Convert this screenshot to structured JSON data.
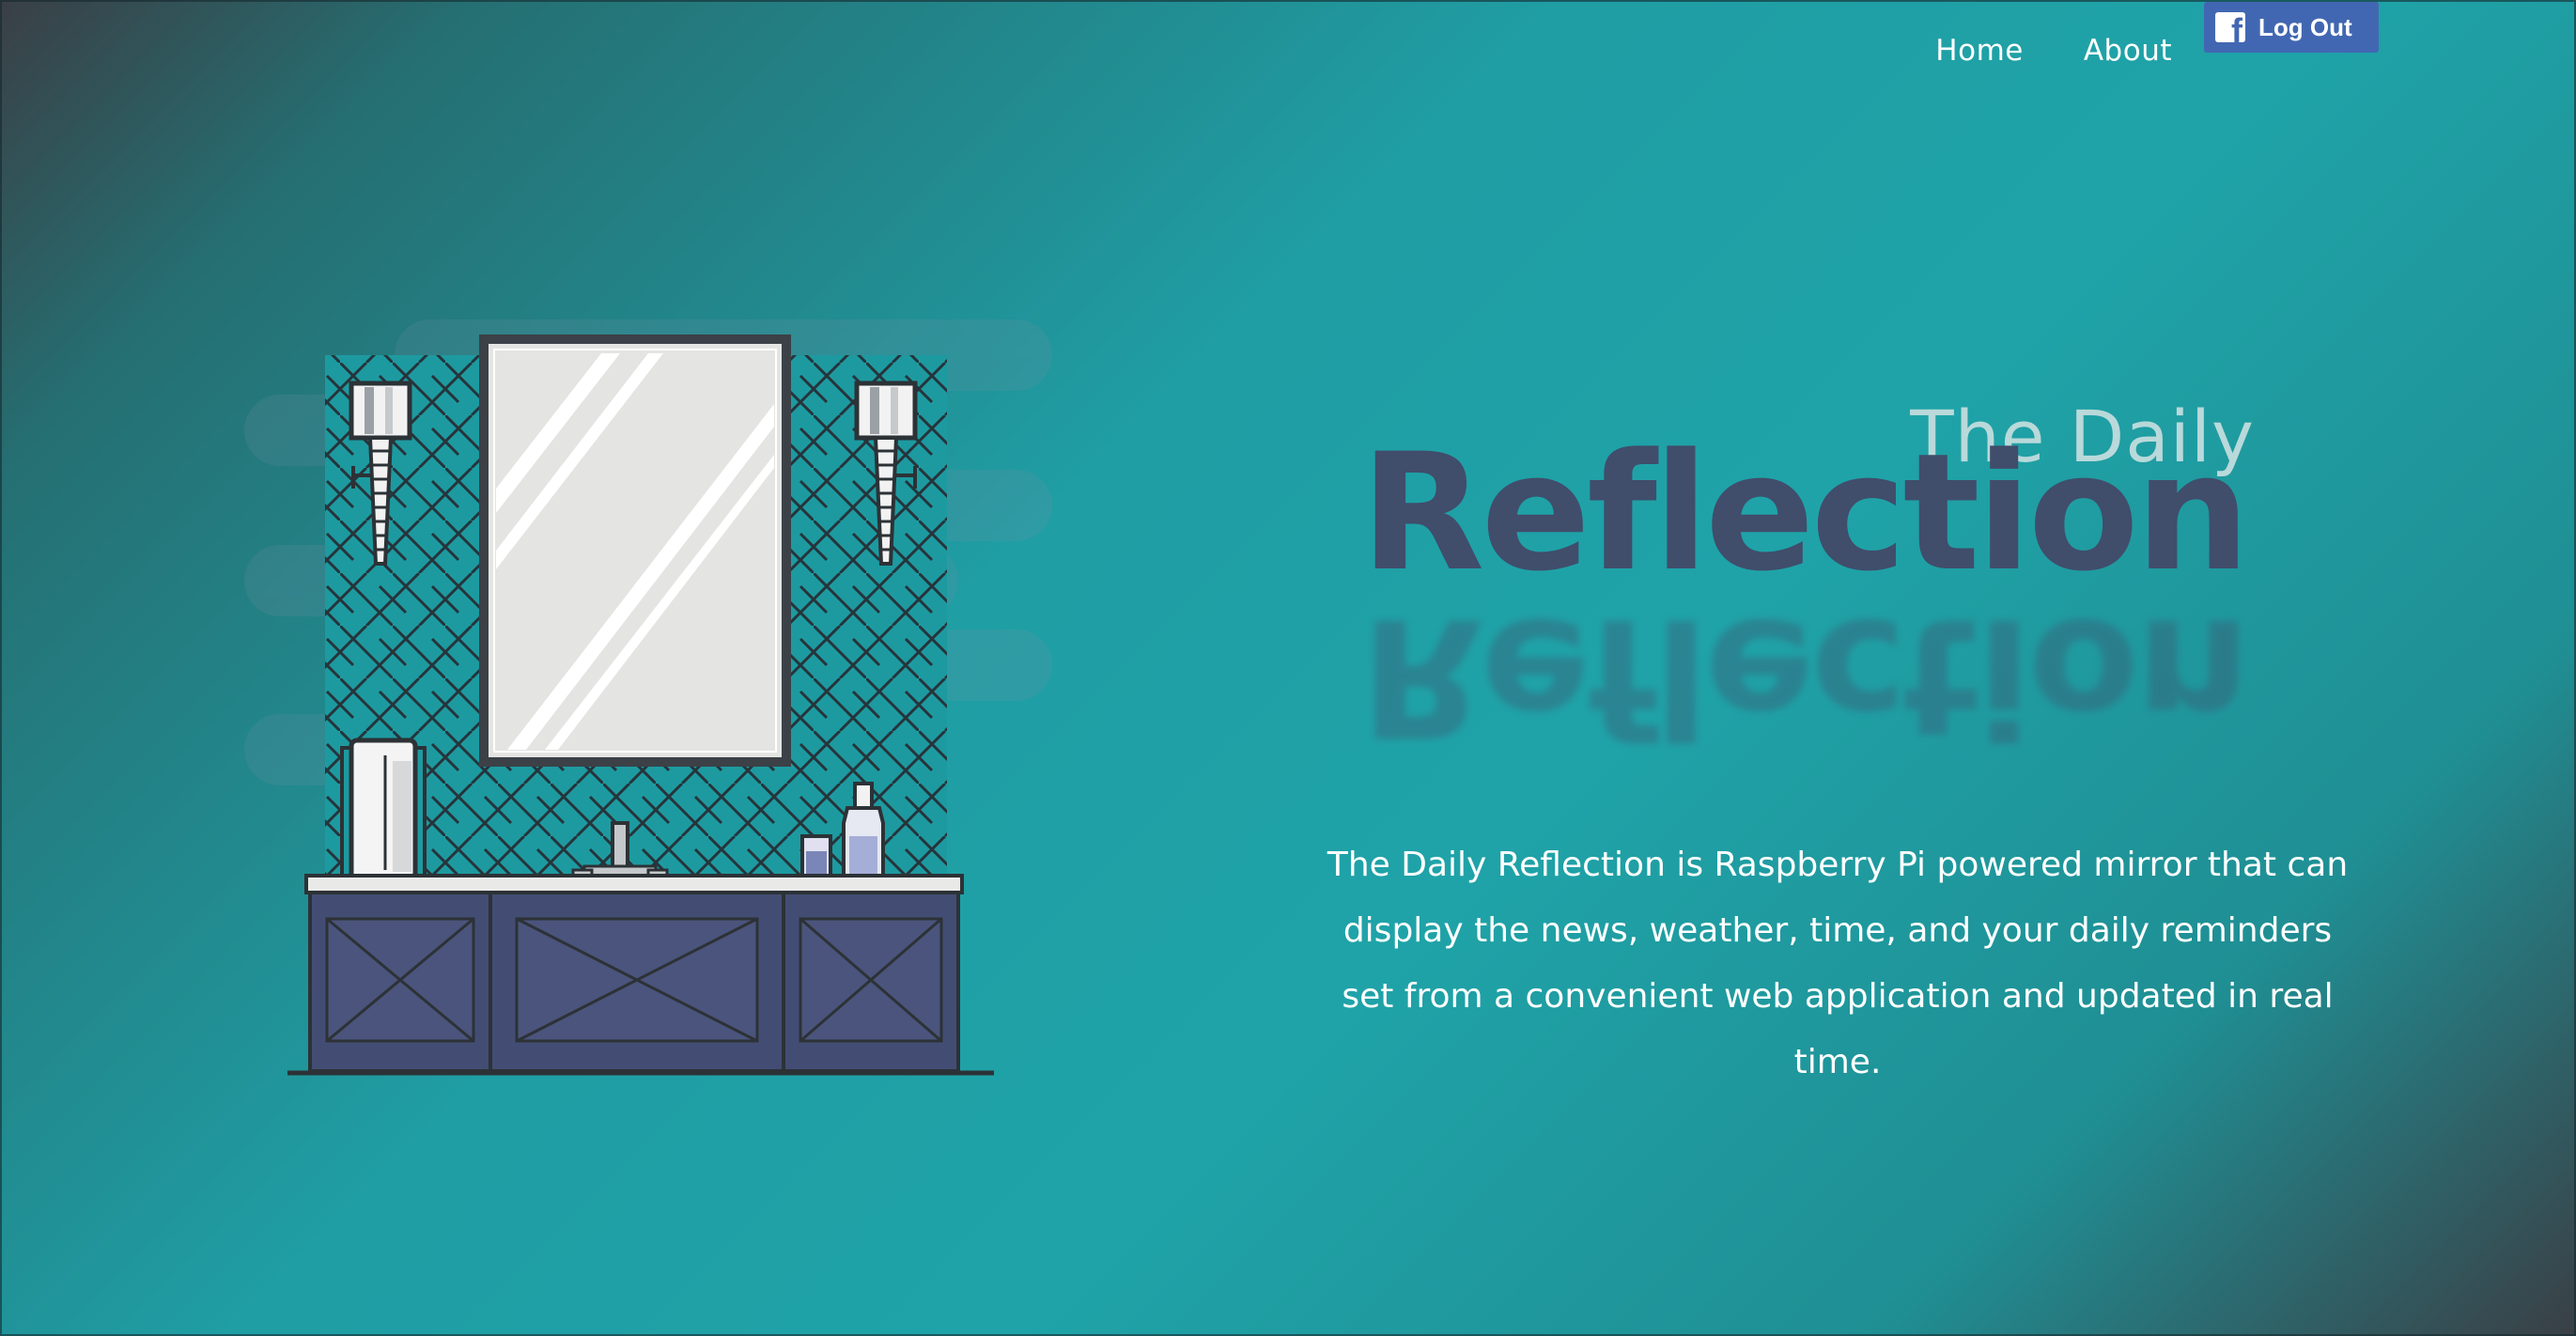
{
  "nav": {
    "home_label": "Home",
    "about_label": "About",
    "logout_label": "Log Out",
    "logout_icon": "facebook-icon"
  },
  "hero": {
    "title_small": "The Daily",
    "title_big": "Reflection",
    "description": "The Daily Reflection is Raspberry Pi powered mirror that can display the news, weather, time, and your daily reminders set from a convenient web application and updated in real time."
  },
  "colors": {
    "background_teal": "#1fa3a8",
    "title_dark": "#404d6b",
    "title_light": "#b9d9da",
    "facebook_blue": "#4267b2",
    "vanity_navy": "#434d74",
    "mirror_glass": "#e4e4e2"
  },
  "illustration": {
    "name": "bathroom-vanity-illustration"
  }
}
